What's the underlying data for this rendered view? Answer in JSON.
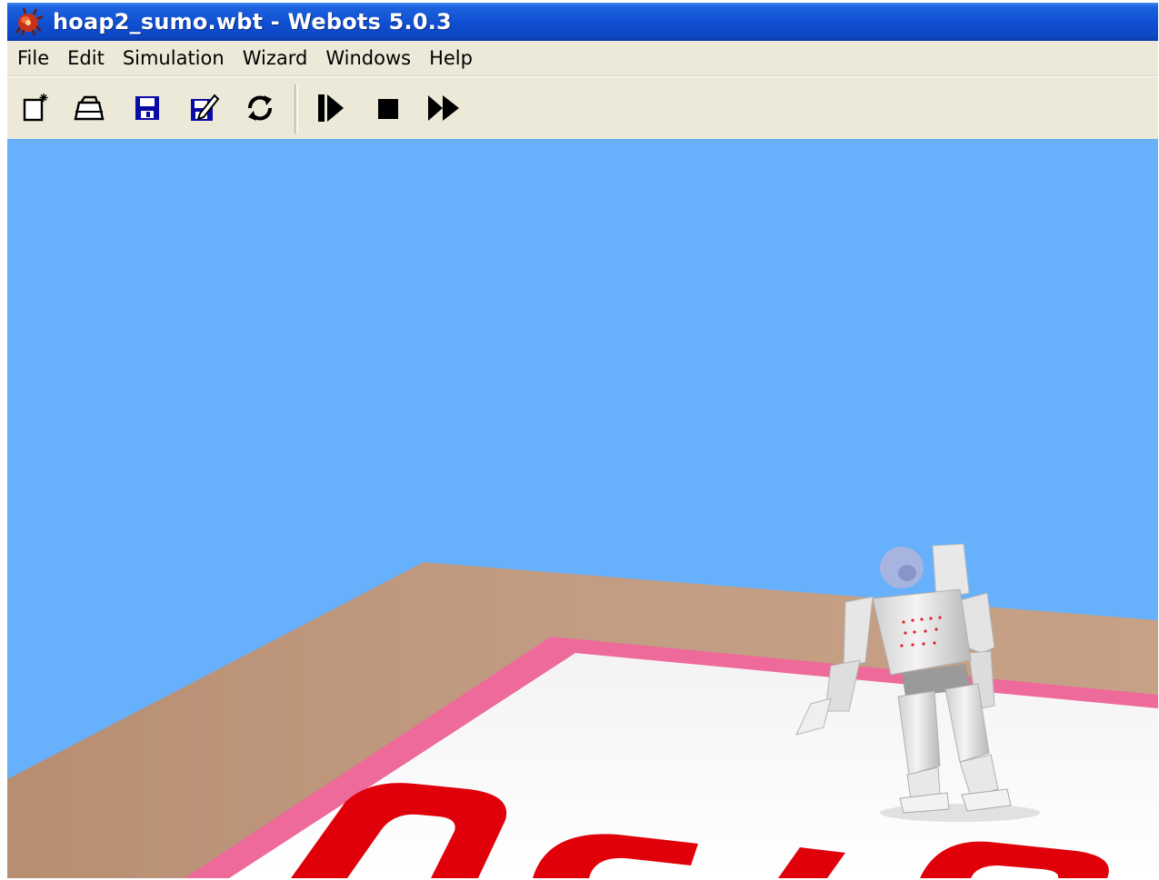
{
  "window": {
    "title": "hoap2_sumo.wbt - Webots 5.0.3"
  },
  "menu": {
    "items": [
      "File",
      "Edit",
      "Simulation",
      "Wizard",
      "Windows",
      "Help"
    ]
  },
  "toolbar": {
    "buttons": [
      {
        "name": "new-world",
        "icon": "new-document-icon"
      },
      {
        "name": "open-world",
        "icon": "open-folder-icon"
      },
      {
        "name": "save-world",
        "icon": "save-disk-icon"
      },
      {
        "name": "save-as",
        "icon": "save-edit-icon"
      },
      {
        "name": "revert",
        "icon": "revert-refresh-icon"
      },
      {
        "name": "step",
        "icon": "step-icon"
      },
      {
        "name": "stop",
        "icon": "stop-icon"
      },
      {
        "name": "run",
        "icon": "fast-forward-icon"
      }
    ]
  },
  "scene": {
    "sky_color": "#66b0fc",
    "floor_color": "#c19a80",
    "ring_border_color": "#ee6a9a",
    "ring_surface_color": "#ffffff",
    "logo_color": "#e0000a"
  },
  "colors": {
    "titlebar_accent": "#0e4fd2",
    "chrome_background": "#ece9d8"
  }
}
